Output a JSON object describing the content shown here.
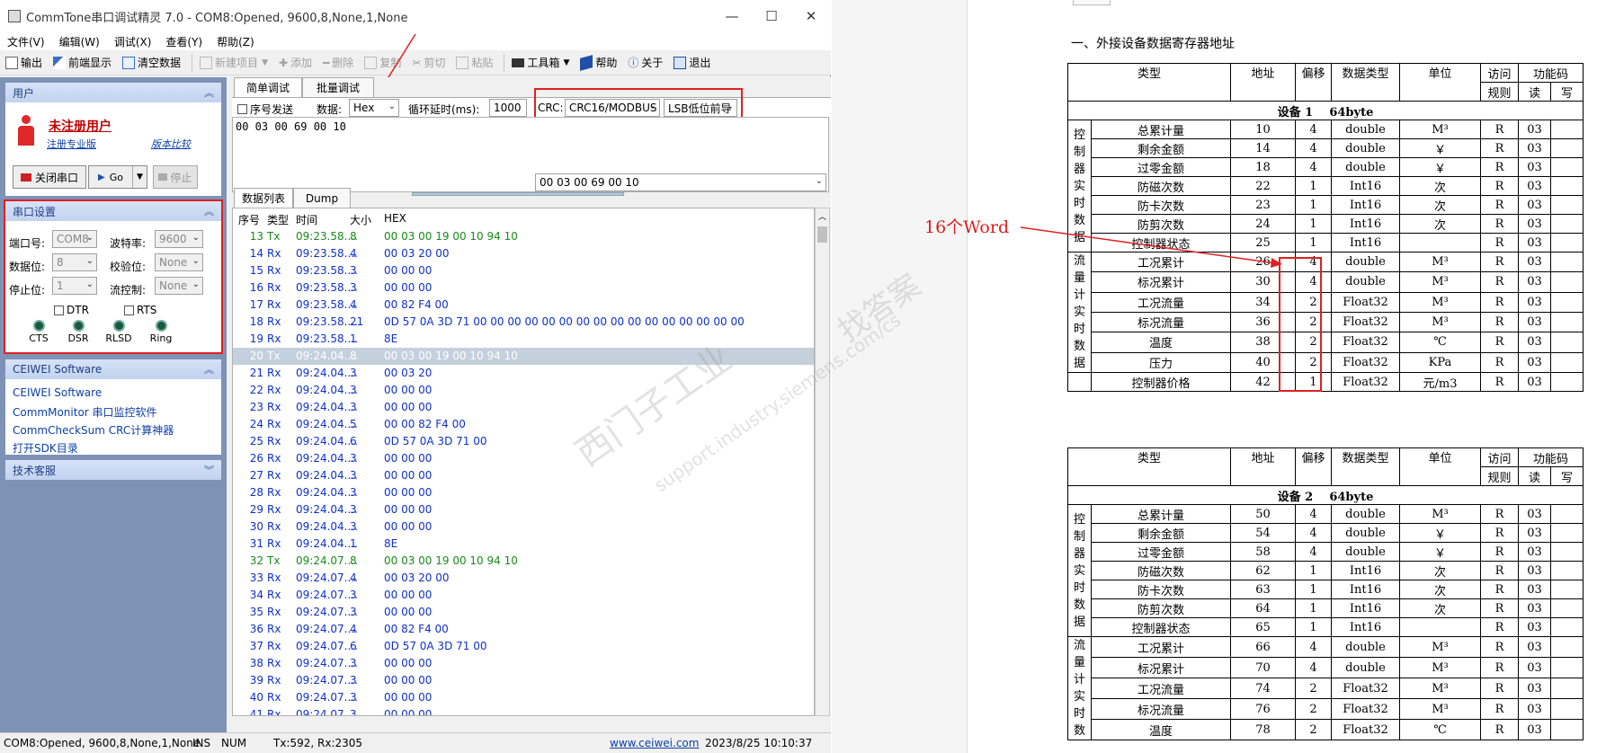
{
  "app": {
    "title": "CommTone串口调试精灵 7.0 - COM8:Opened, 9600,8,None,1,None",
    "window_controls": [
      "—",
      "☐",
      "✕"
    ],
    "menu": [
      "文件(V)",
      "编辑(W)",
      "调试(X)",
      "查看(Y)",
      "帮助(Z)"
    ],
    "toolbar": [
      {
        "label": "输出",
        "icon": "output-icon",
        "enabled": true
      },
      {
        "label": "前端显示",
        "icon": "pin-icon",
        "enabled": true
      },
      {
        "label": "清空数据",
        "icon": "clear-icon",
        "enabled": true
      },
      {
        "label": "新建项目",
        "icon": "new-project-icon",
        "enabled": false,
        "dropdown": true
      },
      {
        "label": "添加",
        "icon": "plus-icon",
        "enabled": false
      },
      {
        "label": "删除",
        "icon": "minus-icon",
        "enabled": false
      },
      {
        "label": "复制",
        "icon": "copy-icon",
        "enabled": false
      },
      {
        "label": "剪切",
        "icon": "scissors-icon",
        "enabled": false
      },
      {
        "label": "粘贴",
        "icon": "paste-icon",
        "enabled": false
      },
      {
        "label": "工具箱",
        "icon": "toolbox-icon",
        "enabled": true,
        "dropdown": true
      },
      {
        "label": "帮助",
        "icon": "help-book-icon",
        "enabled": true
      },
      {
        "label": "关于",
        "icon": "info-icon",
        "enabled": true
      },
      {
        "label": "退出",
        "icon": "exit-icon",
        "enabled": true
      }
    ],
    "user_panel": {
      "header": "用户",
      "user": "未注册用户",
      "register_link": "注册专业版",
      "compare_link": "版本比较",
      "close_port": "关闭串口",
      "go": "Go",
      "stop": "停止"
    },
    "serial_panel": {
      "header": "串口设置",
      "port_label": "端口号:",
      "port": "COM8",
      "baud_label": "波特率:",
      "baud": "9600",
      "databits_label": "数据位:",
      "databits": "8",
      "parity_label": "校验位:",
      "parity": "None",
      "stopbits_label": "停止位:",
      "stopbits": "1",
      "flow_label": "流控制:",
      "flow": "None",
      "dtr": "DTR",
      "rts": "RTS",
      "leds": [
        "CTS",
        "DSR",
        "RLSD",
        "Ring"
      ]
    },
    "ceiwei_panel": {
      "header": "CEIWEI Software",
      "links": [
        "CEIWEI Software",
        "CommMonitor 串口监控软件",
        "CommCheckSum CRC计算神器",
        "打开SDK目录"
      ]
    },
    "support_panel": {
      "header": "技术客服"
    },
    "debug_tabs": [
      "简单调试",
      "批量调试"
    ],
    "send_options": {
      "seq_label": "序号发送",
      "data_label": "数据:",
      "data_format": "Hex",
      "loop_label": "循环延时(ms):",
      "loop_value": "1000",
      "crc_label": "CRC:",
      "crc_type": "CRC16/MODBUS",
      "crc_order": "LSB低位前导"
    },
    "send_hex": "00 03 00 69 00 10",
    "send_preview": "00 03 00 69 00 10",
    "list_tabs": [
      "数据列表",
      "Dump"
    ],
    "columns": [
      "序号",
      "类型",
      "时间",
      "大小",
      "HEX"
    ],
    "rows": [
      {
        "n": "13",
        "t": "Tx",
        "time": "09:23.58....",
        "size": "8",
        "hex": "00 03 00 19 00 10 94 10"
      },
      {
        "n": "14",
        "t": "Rx",
        "time": "09:23.58....",
        "size": "4",
        "hex": "00 03 20 00"
      },
      {
        "n": "15",
        "t": "Rx",
        "time": "09:23.58....",
        "size": "3",
        "hex": "00 00 00"
      },
      {
        "n": "16",
        "t": "Rx",
        "time": "09:23.58....",
        "size": "3",
        "hex": "00 00 00"
      },
      {
        "n": "17",
        "t": "Rx",
        "time": "09:23.58....",
        "size": "4",
        "hex": "00 82 F4 00"
      },
      {
        "n": "18",
        "t": "Rx",
        "time": "09:23.58....",
        "size": "21",
        "hex": "0D 57 0A 3D 71 00 00 00 00 00 00 00 00 00 00 00 00 00 00 00 00"
      },
      {
        "n": "19",
        "t": "Rx",
        "time": "09:23.58....",
        "size": "1",
        "hex": "8E"
      },
      {
        "n": "20",
        "t": "Tx",
        "time": "09:24.04....",
        "size": "8",
        "hex": "00 03 00 19 00 10 94 10",
        "selected": true
      },
      {
        "n": "21",
        "t": "Rx",
        "time": "09:24.04....",
        "size": "3",
        "hex": "00 03 20"
      },
      {
        "n": "22",
        "t": "Rx",
        "time": "09:24.04....",
        "size": "3",
        "hex": "00 00 00"
      },
      {
        "n": "23",
        "t": "Rx",
        "time": "09:24.04....",
        "size": "3",
        "hex": "00 00 00"
      },
      {
        "n": "24",
        "t": "Rx",
        "time": "09:24.04....",
        "size": "5",
        "hex": "00 00 82 F4 00"
      },
      {
        "n": "25",
        "t": "Rx",
        "time": "09:24.04....",
        "size": "6",
        "hex": "0D 57 0A 3D 71 00"
      },
      {
        "n": "26",
        "t": "Rx",
        "time": "09:24.04....",
        "size": "3",
        "hex": "00 00 00"
      },
      {
        "n": "27",
        "t": "Rx",
        "time": "09:24.04....",
        "size": "3",
        "hex": "00 00 00"
      },
      {
        "n": "28",
        "t": "Rx",
        "time": "09:24.04....",
        "size": "3",
        "hex": "00 00 00"
      },
      {
        "n": "29",
        "t": "Rx",
        "time": "09:24.04....",
        "size": "3",
        "hex": "00 00 00"
      },
      {
        "n": "30",
        "t": "Rx",
        "time": "09:24.04....",
        "size": "3",
        "hex": "00 00 00"
      },
      {
        "n": "31",
        "t": "Rx",
        "time": "09:24.04....",
        "size": "1",
        "hex": "8E"
      },
      {
        "n": "32",
        "t": "Tx",
        "time": "09:24.07....",
        "size": "8",
        "hex": "00 03 00 19 00 10 94 10"
      },
      {
        "n": "33",
        "t": "Rx",
        "time": "09:24.07....",
        "size": "4",
        "hex": "00 03 20 00"
      },
      {
        "n": "34",
        "t": "Rx",
        "time": "09:24.07....",
        "size": "3",
        "hex": "00 00 00"
      },
      {
        "n": "35",
        "t": "Rx",
        "time": "09:24.07....",
        "size": "3",
        "hex": "00 00 00"
      },
      {
        "n": "36",
        "t": "Rx",
        "time": "09:24.07....",
        "size": "4",
        "hex": "00 82 F4 00"
      },
      {
        "n": "37",
        "t": "Rx",
        "time": "09:24.07....",
        "size": "6",
        "hex": "0D 57 0A 3D 71 00"
      },
      {
        "n": "38",
        "t": "Rx",
        "time": "09:24.07....",
        "size": "3",
        "hex": "00 00 00"
      },
      {
        "n": "39",
        "t": "Rx",
        "time": "09:24.07....",
        "size": "3",
        "hex": "00 00 00"
      },
      {
        "n": "40",
        "t": "Rx",
        "time": "09:24.07....",
        "size": "3",
        "hex": "00 00 00"
      },
      {
        "n": "41",
        "t": "Rx",
        "time": "09:24.07...",
        "size": "3",
        "hex": "00 00 00"
      }
    ],
    "status": {
      "port": "COM8:Opened, 9600,8,None,1,None",
      "ins": "INS",
      "num": "NUM",
      "count": "Tx:592, Rx:2305",
      "site": "www.ceiwei.com",
      "datetime": "2023/8/25 10:10:37"
    }
  },
  "document": {
    "heading": "一、外接设备数据寄存器地址",
    "annotation": "16个Word",
    "watermark": [
      "找答案",
      "西门子工业",
      "support.industry.siemens.com/cs"
    ],
    "headers": [
      "类型",
      "地址",
      "偏移",
      "数据类型",
      "单位",
      "访问",
      "功能码",
      "规则",
      "读",
      "写"
    ],
    "table1": {
      "device": "设备 1",
      "size": "64byte",
      "group_control": "控制器实时数据",
      "group_flow": "流量计实时数据",
      "rows": [
        {
          "name": "总累计量",
          "addr": "10",
          "off": "4",
          "type": "double",
          "unit": "M³",
          "rule": "R",
          "read": "03"
        },
        {
          "name": "剩余金额",
          "addr": "14",
          "off": "4",
          "type": "double",
          "unit": "￥",
          "rule": "R",
          "read": "03"
        },
        {
          "name": "过零金额",
          "addr": "18",
          "off": "4",
          "type": "double",
          "unit": "￥",
          "rule": "R",
          "read": "03"
        },
        {
          "name": "防磁次数",
          "addr": "22",
          "off": "1",
          "type": "Int16",
          "unit": "次",
          "rule": "R",
          "read": "03"
        },
        {
          "name": "防卡次数",
          "addr": "23",
          "off": "1",
          "type": "Int16",
          "unit": "次",
          "rule": "R",
          "read": "03"
        },
        {
          "name": "防剪次数",
          "addr": "24",
          "off": "1",
          "type": "Int16",
          "unit": "次",
          "rule": "R",
          "read": "03"
        },
        {
          "name": "控制器状态",
          "addr": "25",
          "off": "1",
          "type": "Int16",
          "unit": "",
          "rule": "R",
          "read": "03"
        },
        {
          "name": "工况累计",
          "addr": "26",
          "off": "4",
          "type": "double",
          "unit": "M³",
          "rule": "R",
          "read": "03"
        },
        {
          "name": "标况累计",
          "addr": "30",
          "off": "4",
          "type": "double",
          "unit": "M³",
          "rule": "R",
          "read": "03"
        },
        {
          "name": "工况流量",
          "addr": "34",
          "off": "2",
          "type": "Float32",
          "unit": "M³",
          "rule": "R",
          "read": "03"
        },
        {
          "name": "标况流量",
          "addr": "36",
          "off": "2",
          "type": "Float32",
          "unit": "M³",
          "rule": "R",
          "read": "03"
        },
        {
          "name": "温度",
          "addr": "38",
          "off": "2",
          "type": "Float32",
          "unit": "℃",
          "rule": "R",
          "read": "03"
        },
        {
          "name": "压力",
          "addr": "40",
          "off": "2",
          "type": "Float32",
          "unit": "KPa",
          "rule": "R",
          "read": "03"
        },
        {
          "name": "控制器价格",
          "addr": "42",
          "off": "1",
          "type": "Float32",
          "unit": "元/m3",
          "rule": "R",
          "read": "03"
        }
      ]
    },
    "table2": {
      "device": "设备 2",
      "size": "64byte",
      "group_control": "控制器实时数据",
      "group_flow": "流量计实时数",
      "rows": [
        {
          "name": "总累计量",
          "addr": "50",
          "off": "4",
          "type": "double",
          "unit": "M³",
          "rule": "R",
          "read": "03"
        },
        {
          "name": "剩余金额",
          "addr": "54",
          "off": "4",
          "type": "double",
          "unit": "￥",
          "rule": "R",
          "read": "03"
        },
        {
          "name": "过零金额",
          "addr": "58",
          "off": "4",
          "type": "double",
          "unit": "￥",
          "rule": "R",
          "read": "03"
        },
        {
          "name": "防磁次数",
          "addr": "62",
          "off": "1",
          "type": "Int16",
          "unit": "次",
          "rule": "R",
          "read": "03"
        },
        {
          "name": "防卡次数",
          "addr": "63",
          "off": "1",
          "type": "Int16",
          "unit": "次",
          "rule": "R",
          "read": "03"
        },
        {
          "name": "防剪次数",
          "addr": "64",
          "off": "1",
          "type": "Int16",
          "unit": "次",
          "rule": "R",
          "read": "03"
        },
        {
          "name": "控制器状态",
          "addr": "65",
          "off": "1",
          "type": "Int16",
          "unit": "",
          "rule": "R",
          "read": "03"
        },
        {
          "name": "工况累计",
          "addr": "66",
          "off": "4",
          "type": "double",
          "unit": "M³",
          "rule": "R",
          "read": "03"
        },
        {
          "name": "标况累计",
          "addr": "70",
          "off": "4",
          "type": "double",
          "unit": "M³",
          "rule": "R",
          "read": "03"
        },
        {
          "name": "工况流量",
          "addr": "74",
          "off": "2",
          "type": "Float32",
          "unit": "M³",
          "rule": "R",
          "read": "03"
        },
        {
          "name": "标况流量",
          "addr": "76",
          "off": "2",
          "type": "Float32",
          "unit": "M³",
          "rule": "R",
          "read": "03"
        },
        {
          "name": "温度",
          "addr": "78",
          "off": "2",
          "type": "Float32",
          "unit": "℃",
          "rule": "R",
          "read": "03"
        }
      ]
    }
  },
  "colors": {
    "tx": "#1a8a1a",
    "rx": "#1030c8",
    "highlight": "#e02020",
    "panel_bg": "#7e92b6",
    "selected_row": "#c4d0dc"
  }
}
